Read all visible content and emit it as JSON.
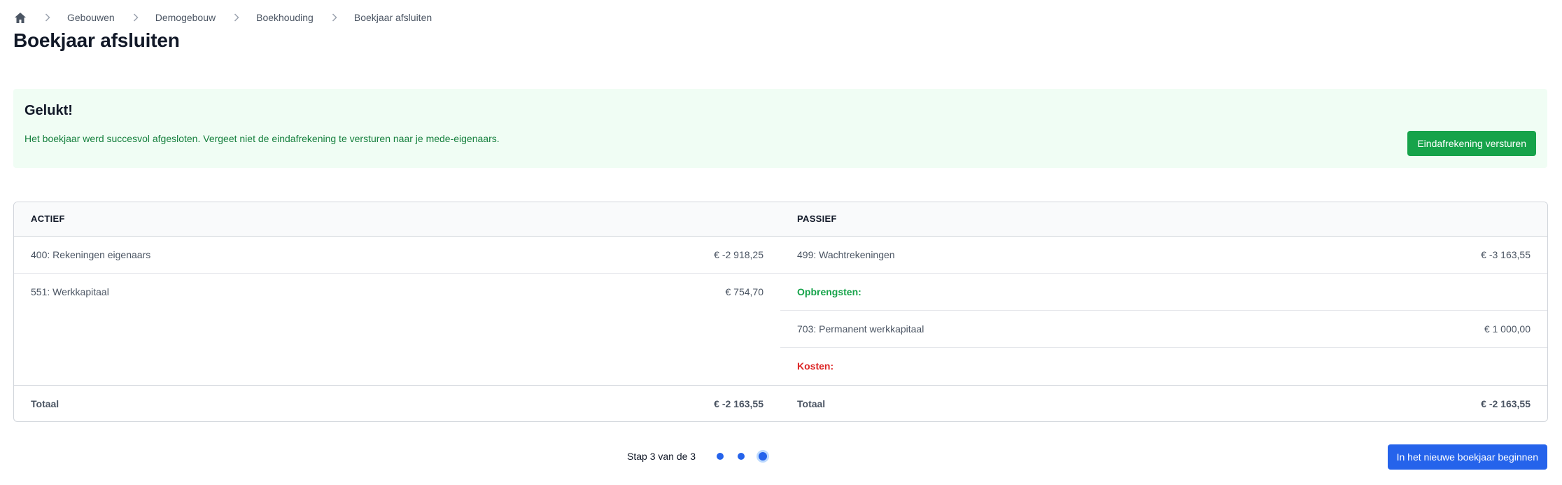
{
  "breadcrumb": {
    "home_icon": "home-icon",
    "separator_icon": "chevron-right-icon",
    "items": [
      "Gebouwen",
      "Demogebouw",
      "Boekhouding",
      "Boekjaar afsluiten"
    ]
  },
  "page": {
    "title": "Boekjaar afsluiten"
  },
  "alert": {
    "title": "Gelukt!",
    "message": "Het boekjaar werd succesvol afgesloten. Vergeet niet de eindafrekening te versturen naar je mede-eigenaars.",
    "button_label": "Eindafrekening versturen",
    "background_color": "#f0fdf4",
    "text_color": "#15803d",
    "button_color": "#16a34a"
  },
  "balance": {
    "actief_header": "ACTIEF",
    "passief_header": "PASSIEF",
    "actief_rows": [
      {
        "label": "400: Rekeningen eigenaars",
        "amount": "€ -2 918,25"
      },
      {
        "label": "551: Werkkapitaal",
        "amount": "€ 754,70"
      }
    ],
    "passief_rows": [
      {
        "label": "499: Wachtrekeningen",
        "amount": "€ -3 163,55"
      },
      {
        "label": "Opbrengsten:",
        "amount": ""
      },
      {
        "label": "703: Permanent werkkapitaal",
        "amount": "€ 1 000,00"
      },
      {
        "label": "Kosten:",
        "amount": ""
      }
    ],
    "actief_total": {
      "label": "Totaal",
      "amount": "€ -2 163,55"
    },
    "passief_total": {
      "label": "Totaal",
      "amount": "€ -2 163,55"
    },
    "opbrengsten_color": "#16a34a",
    "kosten_color": "#dc2626"
  },
  "stepper": {
    "text": "Stap 3 van de 3",
    "current_step": 3,
    "total_steps": 3,
    "dot_color": "#2563eb"
  },
  "footer": {
    "next_button_label": "In het nieuwe boekjaar beginnen",
    "button_color": "#2563eb"
  }
}
